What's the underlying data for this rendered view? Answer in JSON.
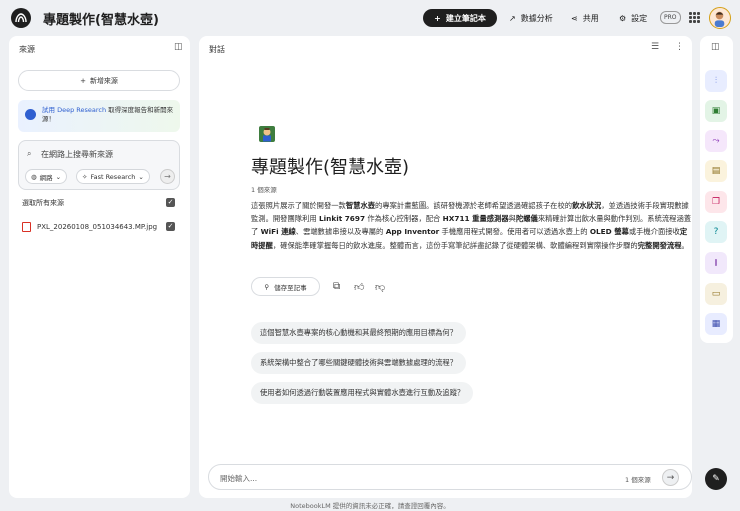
{
  "header": {
    "app_title": "專題製作(智慧水壺)",
    "new_notebook": "建立筆記本",
    "analytics": "數據分析",
    "share": "共用",
    "settings": "設定",
    "pro_badge": "PRO"
  },
  "sources_panel": {
    "title": "來源",
    "add_source": "新增來源",
    "deep_research_link": "試用 Deep Research",
    "deep_research_text": " 取得深度報告和新開來源！",
    "search_placeholder": "在網路上搜尋新來源",
    "chip_web": "網路",
    "chip_research": "Fast Research",
    "select_all": "選取所有來源",
    "files": [
      {
        "name": "PXL_20260108_051034643.MP.jpg"
      }
    ]
  },
  "chat_panel": {
    "title": "對話",
    "notebook_title": "專題製作(智慧水壺)",
    "source_count": "1 個來源",
    "summary_html_parts": [
      "這張照片展示了關於開發一款",
      "智慧水壺",
      "的專案計畫藍圖。該研發機源於老師希望透過確認孩子在校的",
      "飲水狀況",
      "，並透過技術手段實現數據監測。開發團隊利用 ",
      "Linkit 7697",
      " 作為核心控制器，配合 ",
      "HX711 重量感測器",
      "與",
      "陀螺儀",
      "來精確計算出飲水量與動作判別。系統流程涵蓋了 ",
      "WiFi 連線",
      "、雲端數據串接以及專屬的 ",
      "App Inventor",
      " 手機應用程式開發。使用者可以透過水壺上的 ",
      "OLED 螢幕",
      "或手機介面接收",
      "定時提醒",
      "，確保能準確掌握每日的飲水進度。整體而言，這份手寫筆記詳盡記錄了從硬體架構、軟體編程到實際操作步驟的",
      "完整開發流程",
      "。"
    ],
    "save_note": "儲存至記事",
    "suggested_questions": [
      "這個智慧水壺專案的核心動機和其最終預期的應用目標為何？",
      "系統架構中整合了哪些關鍵硬體技術與雲端數據處理的流程？",
      "使用者如何透過行動裝置應用程式與實體水壺進行互動及追蹤？"
    ],
    "input_placeholder": "開始輸入...",
    "input_source_count": "1 個來源"
  },
  "footer": "NotebookLM 提供的資訊未必正確，請查證回覆內容。",
  "studio_icons": [
    "audio-overview-icon",
    "video-overview-icon",
    "mind-map-icon",
    "reports-icon",
    "flashcards-icon",
    "quiz-icon",
    "infographic-icon",
    "slides-icon",
    "data-table-icon"
  ],
  "colors": {
    "accent_dark": "#1f1f1f",
    "deep_research_blue": "#2f5fd0",
    "file_red": "#d93025"
  }
}
